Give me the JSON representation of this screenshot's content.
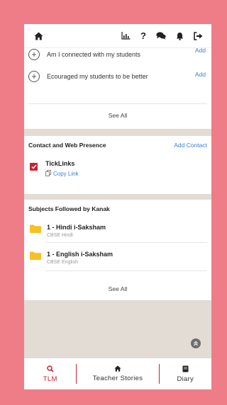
{
  "header": {
    "icons": [
      "home-icon",
      "chart-icon",
      "help-icon",
      "chat-icon",
      "bell-icon",
      "logout-icon"
    ],
    "help_label": "?"
  },
  "progress_list": {
    "items": [
      {
        "label": "Am I connected with my students",
        "action": "Add"
      },
      {
        "label": "Ecouraged my students to be better",
        "action": "Add"
      }
    ],
    "see_all": "See All"
  },
  "contact": {
    "title": "Contact and Web Presence",
    "add_label": "Add Contact",
    "link_name": "TickLinks",
    "copy_label": "Copy Link"
  },
  "subjects": {
    "title": "Subjects Followed by Kanak",
    "items": [
      {
        "name": "1 - Hindi i-Saksham",
        "sub": "CBSE Hindi"
      },
      {
        "name": "1 - English i-Saksham",
        "sub": "CBSE English"
      }
    ],
    "see_all": "See All"
  },
  "bottom_nav": {
    "tlm": "TLM",
    "stories": "Teacher Stories",
    "diary": "Diary"
  },
  "colors": {
    "background": "#ee7d87",
    "accent": "#c72232",
    "link": "#3b7ddd",
    "folder": "#f6c026"
  }
}
